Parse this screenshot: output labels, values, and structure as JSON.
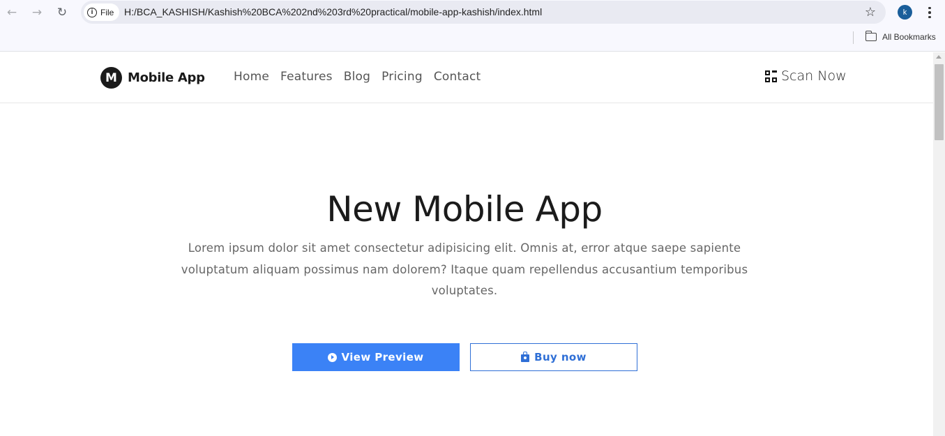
{
  "browser": {
    "back_icon": "←",
    "forward_icon": "→",
    "reload_icon": "↻",
    "scheme_label": "File",
    "url": "H:/BCA_KASHISH/Kashish%20BCA%202nd%203rd%20practical/mobile-app-kashish/index.html",
    "profile_initial": "k",
    "bookmarks_label": "All Bookmarks"
  },
  "site": {
    "brand_initial": "M",
    "brand_name": "Mobile App",
    "nav": [
      "Home",
      "Features",
      "Blog",
      "Pricing",
      "Contact"
    ],
    "scan_label": "Scan Now"
  },
  "hero": {
    "title": "New Mobile App",
    "description": "Lorem ipsum dolor sit amet consectetur adipisicing elit. Omnis at, error atque saepe sapiente voluptatum aliquam possimus nam dolorem? Itaque quam repellendus accusantium temporibus voluptates.",
    "primary_button": "View Preview",
    "secondary_button": "Buy now"
  },
  "colors": {
    "accent": "#3b82f6",
    "outline": "#2f6fd6"
  }
}
